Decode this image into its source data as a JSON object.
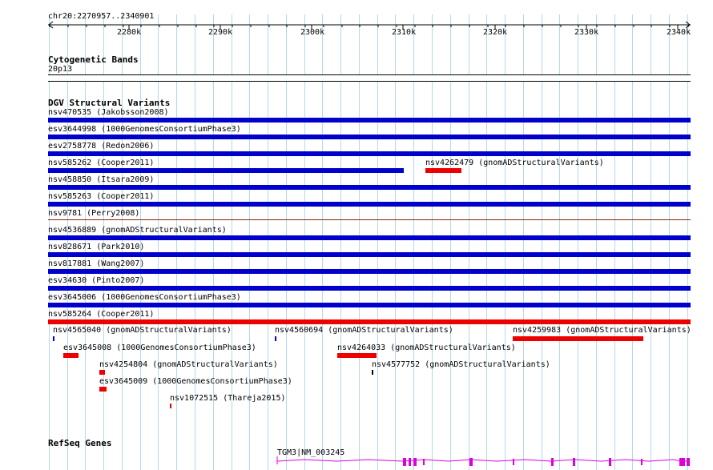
{
  "ruler": {
    "position_label": "chr20:2270957..2340901",
    "start": 2270957,
    "end": 2340901,
    "ticks": [
      "2280k",
      "2290k",
      "2300k",
      "2310k",
      "2320k",
      "2330k",
      "2340k"
    ]
  },
  "cytobands": {
    "title": "Cytogenetic Bands",
    "band_label": "20p13"
  },
  "dgv": {
    "title": "DGV Structural Variants",
    "colors": {
      "blue": "#0000cc",
      "red": "#ee0000",
      "brown": "#8b2500"
    },
    "rows": [
      {
        "label": "nsv470535 (Jakobsson2008)"
      },
      {
        "label": "esv3644998 (1000GenomesConsortiumPhase3)"
      },
      {
        "label": "esv2758778 (Redon2006)"
      },
      {
        "label": "nsv585262 (Cooper2011)"
      },
      {
        "label": "nsv4262479 (gnomADStructuralVariants)"
      },
      {
        "label": "nsv458850 (Itsara2009)"
      },
      {
        "label": "nsv585263 (Cooper2011)"
      },
      {
        "label": "nsv9781 (Perry2008)"
      },
      {
        "label": "nsv4536889 (gnomADStructuralVariants)"
      },
      {
        "label": "nsv828671 (Park2010)"
      },
      {
        "label": "nsv817881 (Wang2007)"
      },
      {
        "label": "esv34630 (Pinto2007)"
      },
      {
        "label": "esv3645006 (1000GenomesConsortiumPhase3)"
      },
      {
        "label": "nsv585264 (Cooper2011)"
      },
      {
        "label": "nsv4565040 (gnomADStructuralVariants)"
      },
      {
        "label": "nsv4560694 (gnomADStructuralVariants)"
      },
      {
        "label": "nsv4259983 (gnomADStructuralVariants)"
      },
      {
        "label": "esv3645008 (1000GenomesConsortiumPhase3)"
      },
      {
        "label": "nsv4264033 (gnomADStructuralVariants)"
      },
      {
        "label": "nsv4254804 (gnomADStructuralVariants)"
      },
      {
        "label": "nsv4577752 (gnomADStructuralVariants)"
      },
      {
        "label": "esv3645009 (1000GenomesConsortiumPhase3)"
      },
      {
        "label": "nsv1072515 (Thareja2015)"
      }
    ]
  },
  "refseq": {
    "title": "RefSeq Genes",
    "gene_label": "TGM3|NM_003245",
    "color": "#dd00dd"
  }
}
